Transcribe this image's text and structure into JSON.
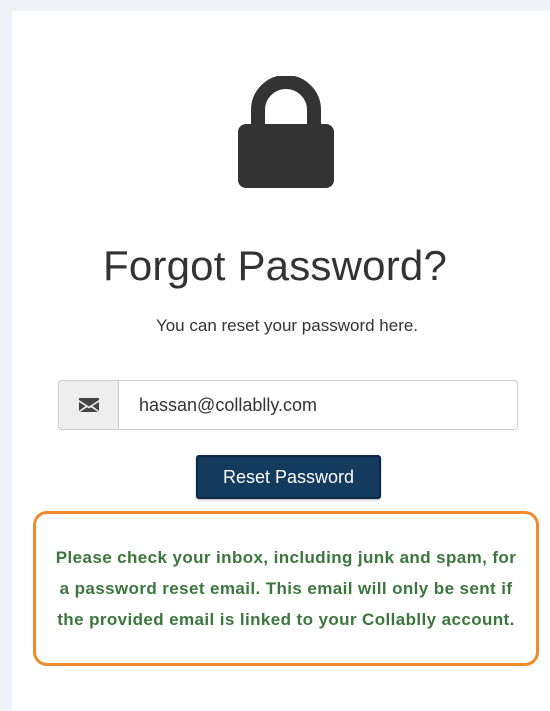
{
  "page": {
    "title": "Forgot Password?",
    "subtitle": "You can reset your password here."
  },
  "form": {
    "email_value": "hassan@collablly.com",
    "email_icon": "envelope-icon",
    "submit_label": "Reset Password"
  },
  "notice": {
    "message": "Please check your inbox, including junk and spam, for a password reset email. This email will only be sent if the provided email is linked to your Collablly account."
  },
  "icons": {
    "lock": "lock-icon"
  },
  "colors": {
    "button_bg": "#143a5e",
    "notice_text": "#3c763d",
    "notice_border": "#f08a2c",
    "lock": "#333333"
  }
}
